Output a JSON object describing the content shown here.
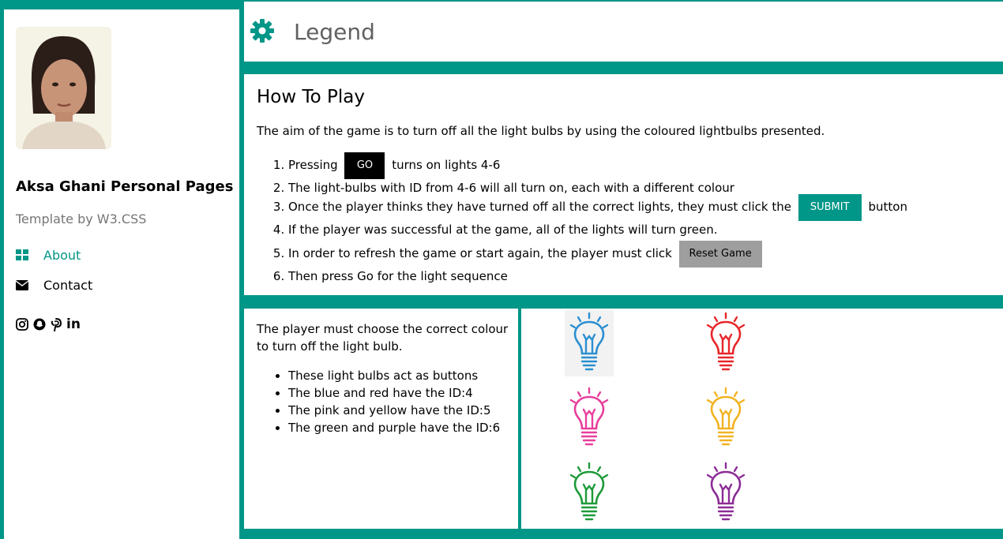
{
  "sidebar": {
    "title": "Aksa Ghani Personal Pages",
    "subtitle": "Template by W3.CSS",
    "nav": [
      {
        "label": "About",
        "icon": "dashboard-icon"
      },
      {
        "label": "Contact",
        "icon": "envelope-icon"
      }
    ],
    "socials": [
      "instagram-icon",
      "snapchat-icon",
      "pinterest-icon",
      "linkedin-icon"
    ],
    "linkedin_text": "in"
  },
  "header": {
    "title": "Legend"
  },
  "how_to_play": {
    "heading": "How To Play",
    "intro": "The aim of the game is to turn off all the light bulbs by using the coloured lightbulbs presented.",
    "step1_before": "Pressing",
    "go_label": "GO",
    "step1_after": "turns on lights 4-6",
    "step2": "The light-bulbs with ID from 4-6 will all turn on, each with a different colour",
    "step3_before": "Once the player thinks they have turned off all the correct lights, they must click the",
    "submit_label": "SUBMIT",
    "step3_after": "button",
    "step4": "If the player was successful at the game, all of the lights will turn green.",
    "step5_before": "In order to refresh the game or start again, the player must click",
    "reset_label": "Reset Game",
    "step6": "Then press Go for the light sequence"
  },
  "info": {
    "paragraph": "The player must choose the correct colour to turn off the light bulb.",
    "bullets": [
      "These light bulbs act as buttons",
      "The blue and red have the ID:4",
      "The pink and yellow have the ID:5",
      "The green and purple have the ID:6"
    ]
  },
  "bulbs": [
    {
      "color": "#2a8fd0",
      "name": "blue"
    },
    {
      "color": "#e8262a",
      "name": "red"
    },
    {
      "color": "#e83e9c",
      "name": "pink"
    },
    {
      "color": "#f2b321",
      "name": "yellow"
    },
    {
      "color": "#1e9a3a",
      "name": "green"
    },
    {
      "color": "#8b2c96",
      "name": "purple"
    }
  ],
  "colors": {
    "accent": "#009688",
    "muted": "#757575",
    "reset": "#9e9e9e"
  }
}
